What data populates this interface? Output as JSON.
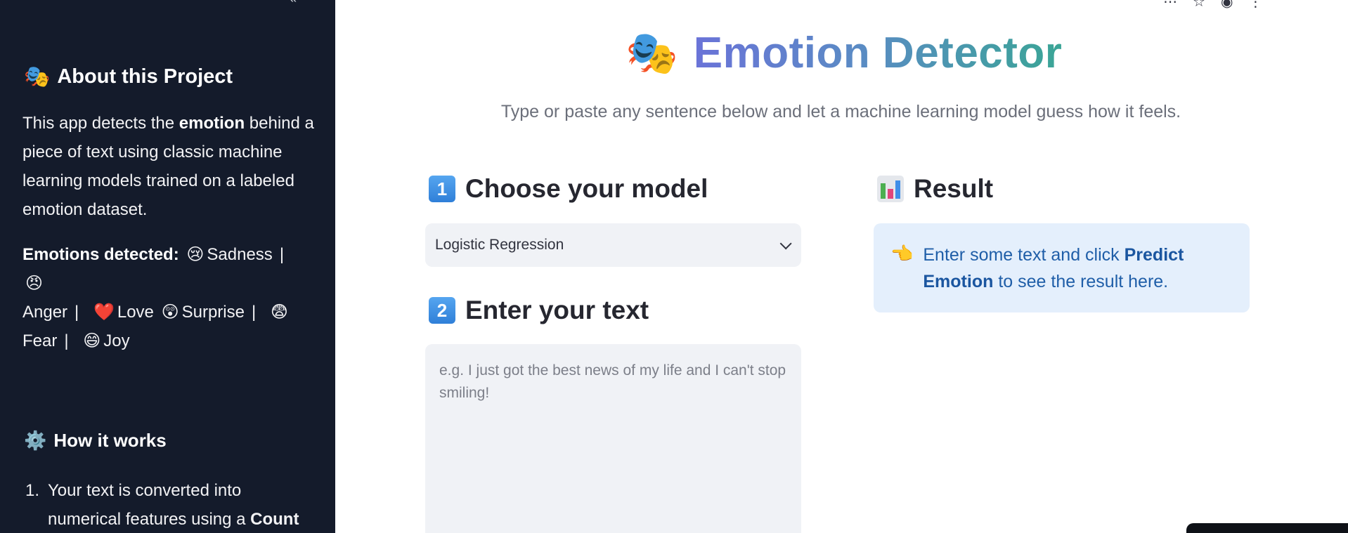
{
  "sidebar": {
    "collapse_glyph": "«",
    "about_emoji": "🎭",
    "about_title": "About this Project",
    "desc_1": "This app detects the ",
    "desc_bold": "emotion",
    "desc_2": " behind a piece of text using classic machine learning models trained on a labeled emotion dataset.",
    "emotions_label": "Emotions detected:",
    "emotions": [
      {
        "emoji": "😢",
        "name": "Sadness"
      },
      {
        "emoji": "😠",
        "name": "Anger"
      },
      {
        "emoji": "❤️",
        "name": "Love"
      },
      {
        "emoji": "😲",
        "name": "Surprise"
      },
      {
        "emoji": "😨",
        "name": "Fear"
      },
      {
        "emoji": "😄",
        "name": "Joy"
      }
    ],
    "sep": "|",
    "how_emoji": "⚙️",
    "how_title": "How it works",
    "step1_num": "1.",
    "step1_a": "Your text is converted into",
    "step1_b": "numerical features using a ",
    "step1_bold": "Count"
  },
  "header": {
    "title_emoji": "🎭",
    "title": "Emotion Detector",
    "subtitle": "Type or paste any sentence below and let a machine learning model guess how it feels.",
    "gradient": [
      "#6a73d8",
      "#3aa596"
    ]
  },
  "model_section": {
    "key": "1",
    "heading": "Choose your model",
    "selected": "Logistic Regression"
  },
  "text_section": {
    "key": "2",
    "heading": "Enter your text",
    "placeholder": "e.g. I just got the best news of my life and I can't stop smiling!"
  },
  "result_section": {
    "heading": "Result",
    "info_emoji": "👈",
    "info_1": "Enter some text and click ",
    "info_bold": "Predict Emotion",
    "info_2": " to see the result here."
  },
  "colors": {
    "sidebar_bg": "#141b2b",
    "info_bg": "#e4effc",
    "info_text": "#1f5ea8",
    "input_bg": "#f0f2f6"
  }
}
